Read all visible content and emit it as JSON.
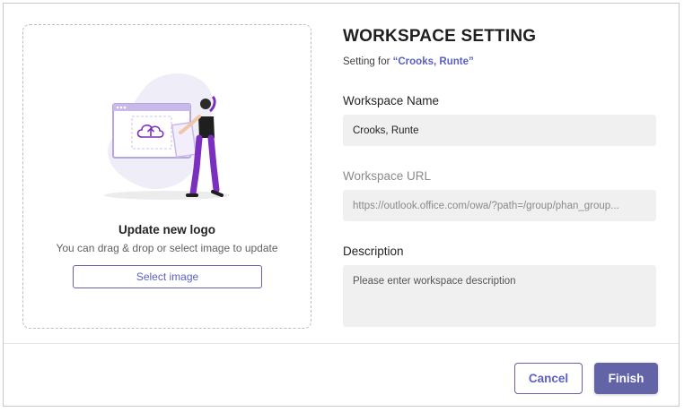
{
  "upload": {
    "title": "Update new logo",
    "subtitle": "You can drag & drop or select image to update",
    "select_label": "Select image",
    "illustration_icon": "cloud-upload-icon"
  },
  "header": {
    "title": "WORKSPACE SETTING",
    "subtitle_prefix": "Setting for",
    "workspace_quoted": "“Crooks, Runte”"
  },
  "fields": {
    "name": {
      "label": "Workspace Name",
      "value": "Crooks, Runte"
    },
    "url": {
      "label": "Workspace URL",
      "value": "https://outlook.office.com/owa/?path=/group/phan_group..."
    },
    "description": {
      "label": "Description",
      "placeholder": "Please enter workspace description"
    }
  },
  "footer": {
    "cancel_label": "Cancel",
    "finish_label": "Finish"
  },
  "colors": {
    "accent": "#6264a7",
    "accent_text": "#5b5fc7",
    "field_bg": "#f0f0f0",
    "illustration_purple": "#7b2fbf"
  }
}
